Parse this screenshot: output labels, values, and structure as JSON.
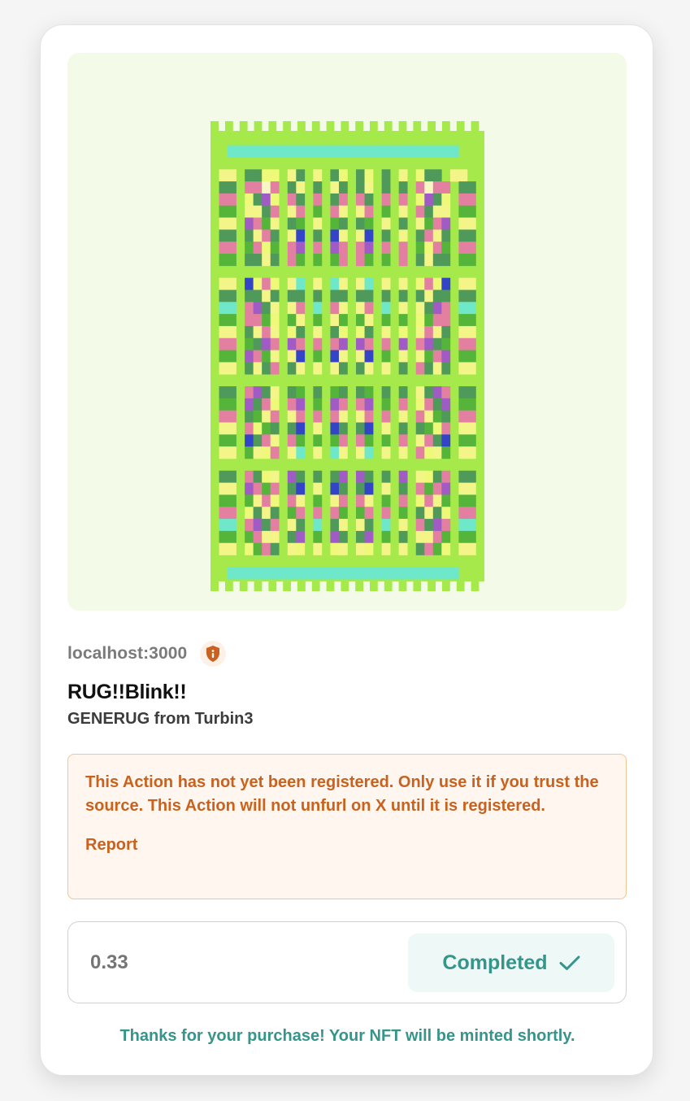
{
  "nft_image": {
    "alt": "Generated pixel rug artwork",
    "rows": [
      "..............................",
      "..............................",
      "..ttttttttttttttttttttttttttt..",
      "..............................",
      ".yy.GGYY.yG.y.GY.GY.G.y.YGG.yy.",
      ".GG.PPwP.Gy.G.yG.Gy.G.G.PwPP.GG.",
      ".PP.YGVY.PG.P.GP.PG.P.P.YVGY.PP.",
      ".gg.yyGP.yP.g.Py.yP.g.y.PGyy.gg.",
      ".yy.VPgy.Gg.y.gG.Gg.y.G.ygPV.yy.",
      ".GG.GyPG.yB.G.By.yB.G.y.GPyG.GG.",
      ".PP.gPYg.PV.P.VP.PV.P.P.gYPg.PP.",
      ".gg.GGyG.Pg.g.gP.Pg.g.P.GyGG.gg.",
      "..............................",
      ".yy.BYPY.yt.y.ty.yt.y.y.YPYB.yy.",
      ".GG.GGyG.GG.G.GG.GG.G.G.GyGG.GG.",
      ".tt.PVGy.yP.t.Py.yP.t.y.yGVP.tt.",
      ".gg.PPgY.gy.g.yg.gy.g.g.YgPP.gg.",
      ".yy.GyPy.YG.y.GY.YG.y.Y.yPyG.yy.",
      ".PP.gGVP.VP.P.PV.VP.P.V.PVGg.PP.",
      ".gg.VPgy.yB.g.By.yB.g.y.ygPV.gg.",
      ".yy.GyGP.Gy.y.yG.Gy.y.G.PGyG.yy.",
      "..............................",
      ".GG.PVGy.Gg.G.gG.Gg.G.G.yGVP.GG.",
      ".gg.VGPY.PV.g.VP.PV.g.P.YPGV.gg.",
      ".PP.GgyP.yP.P.Py.yP.P.y.PygG.PP.",
      ".yy.PYgG.GB.y.BG.GB.y.G.GgYP.yy.",
      ".gg.BGPy.Pg.g.gP.Pg.g.P.yPGB.gg.",
      ".yy.gyYP.yt.y.ty.yt.y.y.PYyg.yy.",
      "..............................",
      ".GG.PGYy.VG.G.GV.VG.G.V.yYGP.GG.",
      ".yy.VPgP.GB.y.BG.GB.y.G.PgPV.yy.",
      ".gg.gyPY.Py.g.yP.Py.g.P.YPyg.gg.",
      ".PP.YGyG.gP.P.Pg.gP.P.g.GyGY.PP.",
      ".tt.PVGP.yG.t.Gy.yG.t.y.PGVP.tt.",
      ".gg.gPyy.GV.g.VG.GV.g.G.yyPg.gg.",
      ".yy.YgPG.yY.y.Yy.yY.y.y.GPgY.yy.",
      "..............................",
      "..ttttttttttttttttttttttttttt..",
      ".............................."
    ],
    "palette": {
      ".": "#a6e94a",
      "t": "#6fe7c9",
      "y": "#f4f589",
      "G": "#4f9a5a",
      "g": "#55b53a",
      "P": "#e37fa0",
      "w": "#f7f7c5",
      "V": "#a05bc4",
      "B": "#3444c6",
      "Y": "#eef97a"
    }
  },
  "domain": {
    "text": "localhost:3000",
    "badge_icon": "shield-info-icon",
    "badge_color": "#c8621e"
  },
  "title": "RUG!!Blink!!",
  "subtitle": "GENERUG from Turbin3",
  "warning": {
    "message": "This Action has not yet been registered. Only use it if you trust the source. This Action will not unfurl on X until it is registered.",
    "report_label": "Report"
  },
  "action": {
    "amount_placeholder": "0.33",
    "button_label": "Completed",
    "button_icon": "checkmark-icon"
  },
  "success_message": "Thanks for your purchase! Your NFT will be minted shortly.",
  "colors": {
    "accent_teal": "#36958a",
    "warning_orange": "#c8621e",
    "warning_bg": "#fff6ef",
    "image_bg": "#f3fbe8"
  }
}
